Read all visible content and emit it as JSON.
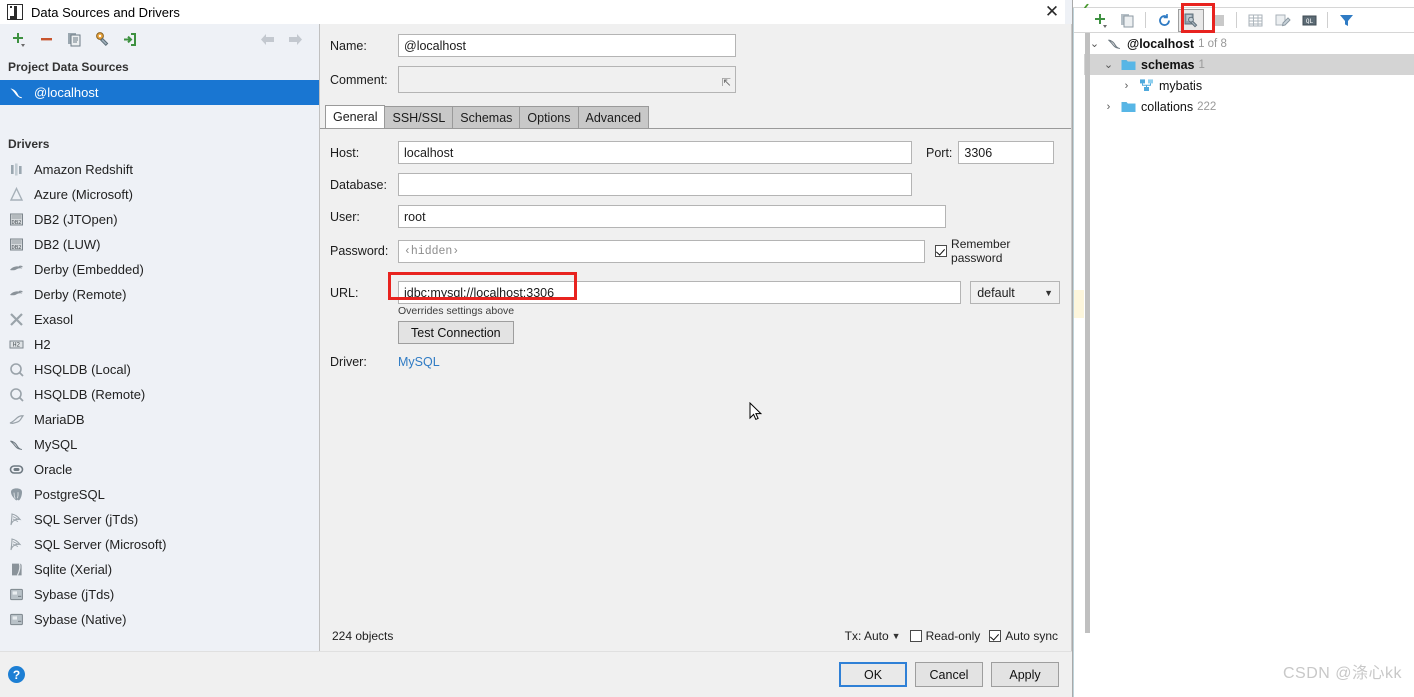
{
  "dialog": {
    "title": "Data Sources and Drivers",
    "close_label": "✕",
    "toolbar": [
      {
        "name": "add",
        "icon": "plus-icon"
      },
      {
        "name": "remove",
        "icon": "minus-icon"
      },
      {
        "name": "copy",
        "icon": "copy-icon"
      },
      {
        "name": "properties",
        "icon": "wrench-icon"
      },
      {
        "name": "import",
        "icon": "import-icon"
      }
    ],
    "nav": {
      "back": "⇦",
      "forward": "⇨"
    }
  },
  "left_pane": {
    "project_group_label": "Project Data Sources",
    "data_sources": [
      {
        "label": "@localhost",
        "icon": "mysql-dolphin-icon",
        "selected": true
      }
    ],
    "drivers_group_label": "Drivers",
    "drivers": [
      {
        "label": "Amazon Redshift",
        "icon": "redshift-icon"
      },
      {
        "label": "Azure (Microsoft)",
        "icon": "azure-icon"
      },
      {
        "label": "DB2 (JTOpen)",
        "icon": "db2-icon"
      },
      {
        "label": "DB2 (LUW)",
        "icon": "db2-icon"
      },
      {
        "label": "Derby (Embedded)",
        "icon": "derby-icon"
      },
      {
        "label": "Derby (Remote)",
        "icon": "derby-icon"
      },
      {
        "label": "Exasol",
        "icon": "exasol-icon"
      },
      {
        "label": "H2",
        "icon": "h2-icon"
      },
      {
        "label": "HSQLDB (Local)",
        "icon": "hsqldb-icon"
      },
      {
        "label": "HSQLDB (Remote)",
        "icon": "hsqldb-icon"
      },
      {
        "label": "MariaDB",
        "icon": "mariadb-icon"
      },
      {
        "label": "MySQL",
        "icon": "mysql-dolphin-icon"
      },
      {
        "label": "Oracle",
        "icon": "oracle-icon"
      },
      {
        "label": "PostgreSQL",
        "icon": "postgresql-icon"
      },
      {
        "label": "SQL Server (jTds)",
        "icon": "sqlserver-icon"
      },
      {
        "label": "SQL Server (Microsoft)",
        "icon": "sqlserver-icon"
      },
      {
        "label": "Sqlite (Xerial)",
        "icon": "sqlite-icon"
      },
      {
        "label": "Sybase (jTds)",
        "icon": "sybase-icon"
      },
      {
        "label": "Sybase (Native)",
        "icon": "sybase-icon"
      }
    ]
  },
  "form": {
    "name_label": "Name:",
    "name_value": "@localhost",
    "comment_label": "Comment:",
    "comment_value": "",
    "tabs": [
      {
        "label": "General",
        "active": true
      },
      {
        "label": "SSH/SSL",
        "active": false
      },
      {
        "label": "Schemas",
        "active": false
      },
      {
        "label": "Options",
        "active": false
      },
      {
        "label": "Advanced",
        "active": false
      }
    ],
    "host_label": "Host:",
    "host_value": "localhost",
    "port_label": "Port:",
    "port_value": "3306",
    "database_label": "Database:",
    "database_value": "",
    "user_label": "User:",
    "user_value": "root",
    "password_label": "Password:",
    "password_value": "‹hidden›",
    "remember_password_label": "Remember password",
    "remember_password_checked": true,
    "url_label": "URL:",
    "url_value": "jdbc:mysql://localhost:3306",
    "url_highlight_color": "#e8231f",
    "url_mode_value": "default",
    "overrides_note": "Overrides settings above",
    "test_connection_label": "Test Connection",
    "driver_label": "Driver:",
    "driver_value": "MySQL",
    "driver_link_color": "#2f7bc4"
  },
  "status": {
    "objects_count": "224 objects",
    "tx_label": "Tx: Auto",
    "read_only_label": "Read-only",
    "read_only_checked": false,
    "auto_sync_label": "Auto sync",
    "auto_sync_checked": true
  },
  "footer": {
    "help_label": "?",
    "ok_label": "OK",
    "cancel_label": "Cancel",
    "apply_label": "Apply"
  },
  "right_panel": {
    "toolbar": [
      {
        "name": "add",
        "icon": "plus-icon",
        "highlighted": false
      },
      {
        "name": "copy",
        "icon": "copy-icon",
        "highlighted": false
      },
      {
        "name": "refresh",
        "icon": "refresh-icon",
        "highlighted": false
      },
      {
        "name": "properties",
        "icon": "wrench-icon",
        "highlighted": true
      },
      {
        "name": "stop",
        "icon": "stop-icon",
        "highlighted": false
      },
      {
        "name": "table",
        "icon": "table-icon",
        "highlighted": false
      },
      {
        "name": "edit-data",
        "icon": "edit-data-icon",
        "highlighted": false
      },
      {
        "name": "console",
        "icon": "sql-console-icon",
        "highlighted": false
      },
      {
        "name": "filter",
        "icon": "filter-icon",
        "highlighted": false
      }
    ],
    "highlight_color": "#e8231f",
    "tree": [
      {
        "label": "@localhost",
        "count": "1 of 8",
        "icon": "mysql-dolphin-icon",
        "depth": 0,
        "expanded": true,
        "bold": true,
        "selected": false
      },
      {
        "label": "schemas",
        "count": "1",
        "icon": "folder-icon",
        "depth": 1,
        "expanded": true,
        "bold": true,
        "selected": true
      },
      {
        "label": "mybatis",
        "count": "",
        "icon": "schema-icon",
        "depth": 2,
        "expanded": false,
        "bold": false,
        "selected": false
      },
      {
        "label": "collations",
        "count": "222",
        "icon": "folder-icon",
        "depth": 1,
        "expanded": false,
        "bold": false,
        "selected": false
      }
    ]
  },
  "watermark": "CSDN @涤心kk"
}
